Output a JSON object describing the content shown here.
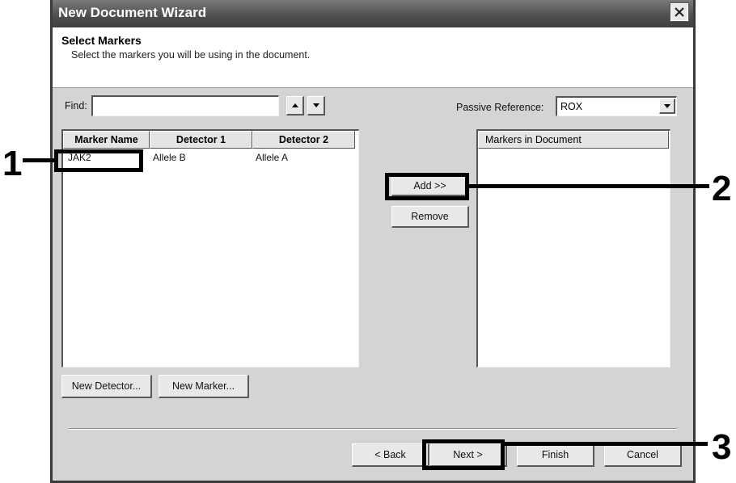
{
  "window": {
    "title": "New Document Wizard",
    "close_icon": "close-icon"
  },
  "header": {
    "title": "Select Markers",
    "subtitle": "Select the markers you will be using in the document."
  },
  "find": {
    "label": "Find:",
    "value": "",
    "up_icon": "arrow-up-icon",
    "down_icon": "arrow-down-icon"
  },
  "passive_reference": {
    "label": "Passive Reference:",
    "value": "ROX",
    "dropdown_icon": "chevron-down-icon"
  },
  "marker_table": {
    "columns": [
      "Marker Name",
      "Detector 1",
      "Detector 2"
    ],
    "rows": [
      [
        "JAK2",
        "Allele B",
        "Allele A"
      ]
    ]
  },
  "markers_in_document": {
    "header": "Markers in Document",
    "items": []
  },
  "buttons": {
    "add": "Add >>",
    "remove": "Remove",
    "new_detector": "New Detector...",
    "new_marker": "New Marker...",
    "back": "< Back",
    "next": "Next >",
    "finish": "Finish",
    "cancel": "Cancel"
  },
  "annotations": [
    "1",
    "2",
    "3"
  ]
}
